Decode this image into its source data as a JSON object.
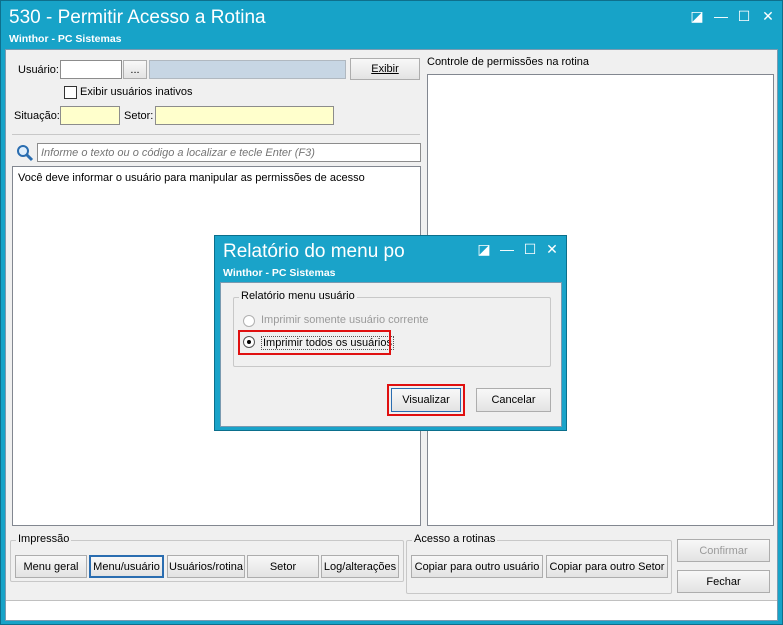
{
  "window": {
    "title": "530 - Permitir Acesso a Rotina",
    "subtitle": "Winthor - PC Sistemas",
    "controls": {
      "restore": "◪",
      "minimize": "—",
      "maximize": "☐",
      "close": "✕"
    }
  },
  "form": {
    "usuario_label": "Usuário:",
    "browse_label": "...",
    "exibir_label": "Exibir",
    "inactive_label": "Exibir usuários inativos",
    "situacao_label": "Situação:",
    "setor_label": "Setor:"
  },
  "search": {
    "icon": "search-icon",
    "placeholder": "Informe o texto ou o código a localizar e tecle Enter (F3)"
  },
  "left_panel": {
    "message": "Você deve informar o usuário para manipular as permissões de acesso"
  },
  "right_panel": {
    "title": "Controle de permissões na rotina"
  },
  "impressao": {
    "title": "Impressão",
    "buttons": [
      "Menu geral",
      "Menu/usuário",
      "Usuários/rotina",
      "Setor",
      "Log/alterações"
    ]
  },
  "acesso": {
    "title": "Acesso a rotinas",
    "buttons": [
      "Copiar para outro usuário",
      "Copiar para outro Setor"
    ]
  },
  "actions": {
    "confirmar": "Confirmar",
    "fechar": "Fechar"
  },
  "dialog": {
    "title": "Relatório do menu po",
    "subtitle": "Winthor - PC Sistemas",
    "group_title": "Relatório menu usuário",
    "option_current": "Imprimir somente usuário corrente",
    "option_all": "Imprimir todos os usuários",
    "selected": "option_all",
    "visualizar": "Visualizar",
    "cancelar": "Cancelar"
  },
  "colors": {
    "titlebar": "#17a3c8",
    "highlight": "#e01010",
    "yellow_field": "#ffffcc"
  }
}
